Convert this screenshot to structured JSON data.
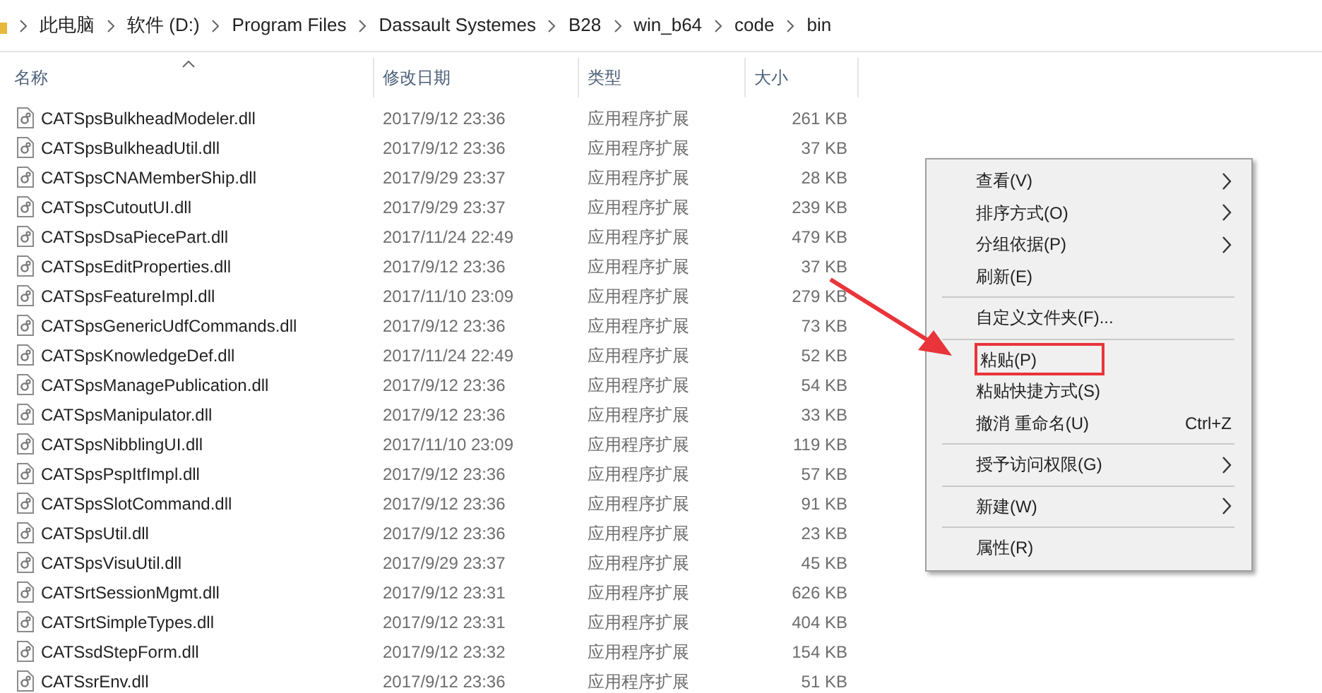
{
  "breadcrumb": [
    "此电脑",
    "软件 (D:)",
    "Program Files",
    "Dassault Systemes",
    "B28",
    "win_b64",
    "code",
    "bin"
  ],
  "columns": [
    {
      "label": "名称",
      "sorted": true
    },
    {
      "label": "修改日期",
      "sorted": false
    },
    {
      "label": "类型",
      "sorted": false
    },
    {
      "label": "大小",
      "sorted": false
    }
  ],
  "rows": [
    {
      "name": "CATSpsBulkheadModeler.dll",
      "date": "2017/9/12 23:36",
      "type": "应用程序扩展",
      "size": "261 KB"
    },
    {
      "name": "CATSpsBulkheadUtil.dll",
      "date": "2017/9/12 23:36",
      "type": "应用程序扩展",
      "size": "37 KB"
    },
    {
      "name": "CATSpsCNAMemberShip.dll",
      "date": "2017/9/29 23:37",
      "type": "应用程序扩展",
      "size": "28 KB"
    },
    {
      "name": "CATSpsCutoutUI.dll",
      "date": "2017/9/29 23:37",
      "type": "应用程序扩展",
      "size": "239 KB"
    },
    {
      "name": "CATSpsDsaPiecePart.dll",
      "date": "2017/11/24 22:49",
      "type": "应用程序扩展",
      "size": "479 KB"
    },
    {
      "name": "CATSpsEditProperties.dll",
      "date": "2017/9/12 23:36",
      "type": "应用程序扩展",
      "size": "37 KB"
    },
    {
      "name": "CATSpsFeatureImpl.dll",
      "date": "2017/11/10 23:09",
      "type": "应用程序扩展",
      "size": "279 KB"
    },
    {
      "name": "CATSpsGenericUdfCommands.dll",
      "date": "2017/9/12 23:36",
      "type": "应用程序扩展",
      "size": "73 KB"
    },
    {
      "name": "CATSpsKnowledgeDef.dll",
      "date": "2017/11/24 22:49",
      "type": "应用程序扩展",
      "size": "52 KB"
    },
    {
      "name": "CATSpsManagePublication.dll",
      "date": "2017/9/12 23:36",
      "type": "应用程序扩展",
      "size": "54 KB"
    },
    {
      "name": "CATSpsManipulator.dll",
      "date": "2017/9/12 23:36",
      "type": "应用程序扩展",
      "size": "33 KB"
    },
    {
      "name": "CATSpsNibblingUI.dll",
      "date": "2017/11/10 23:09",
      "type": "应用程序扩展",
      "size": "119 KB"
    },
    {
      "name": "CATSpsPspItfImpl.dll",
      "date": "2017/9/12 23:36",
      "type": "应用程序扩展",
      "size": "57 KB"
    },
    {
      "name": "CATSpsSlotCommand.dll",
      "date": "2017/9/12 23:36",
      "type": "应用程序扩展",
      "size": "91 KB"
    },
    {
      "name": "CATSpsUtil.dll",
      "date": "2017/9/12 23:36",
      "type": "应用程序扩展",
      "size": "23 KB"
    },
    {
      "name": "CATSpsVisuUtil.dll",
      "date": "2017/9/29 23:37",
      "type": "应用程序扩展",
      "size": "45 KB"
    },
    {
      "name": "CATSrtSessionMgmt.dll",
      "date": "2017/9/12 23:31",
      "type": "应用程序扩展",
      "size": "626 KB"
    },
    {
      "name": "CATSrtSimpleTypes.dll",
      "date": "2017/9/12 23:31",
      "type": "应用程序扩展",
      "size": "404 KB"
    },
    {
      "name": "CATSsdStepForm.dll",
      "date": "2017/9/12 23:32",
      "type": "应用程序扩展",
      "size": "154 KB"
    },
    {
      "name": "CATSsrEnv.dll",
      "date": "2017/9/12 23:36",
      "type": "应用程序扩展",
      "size": "51 KB"
    }
  ],
  "context_menu": [
    {
      "kind": "item",
      "label": "查看(V)",
      "submenu": true,
      "highlighted": false
    },
    {
      "kind": "item",
      "label": "排序方式(O)",
      "submenu": true,
      "highlighted": false
    },
    {
      "kind": "item",
      "label": "分组依据(P)",
      "submenu": true,
      "highlighted": false
    },
    {
      "kind": "item",
      "label": "刷新(E)",
      "submenu": false,
      "highlighted": false
    },
    {
      "kind": "separator"
    },
    {
      "kind": "item",
      "label": "自定义文件夹(F)...",
      "submenu": false,
      "highlighted": false
    },
    {
      "kind": "separator"
    },
    {
      "kind": "item",
      "label": "粘贴(P)",
      "submenu": false,
      "highlighted": true
    },
    {
      "kind": "item",
      "label": "粘贴快捷方式(S)",
      "submenu": false,
      "highlighted": false
    },
    {
      "kind": "item",
      "label": "撤消 重命名(U)",
      "shortcut": "Ctrl+Z",
      "submenu": false,
      "highlighted": false
    },
    {
      "kind": "separator"
    },
    {
      "kind": "item",
      "label": "授予访问权限(G)",
      "submenu": true,
      "highlighted": false
    },
    {
      "kind": "separator"
    },
    {
      "kind": "item",
      "label": "新建(W)",
      "submenu": true,
      "highlighted": false
    },
    {
      "kind": "separator"
    },
    {
      "kind": "item",
      "label": "属性(R)",
      "submenu": false,
      "highlighted": false
    }
  ]
}
